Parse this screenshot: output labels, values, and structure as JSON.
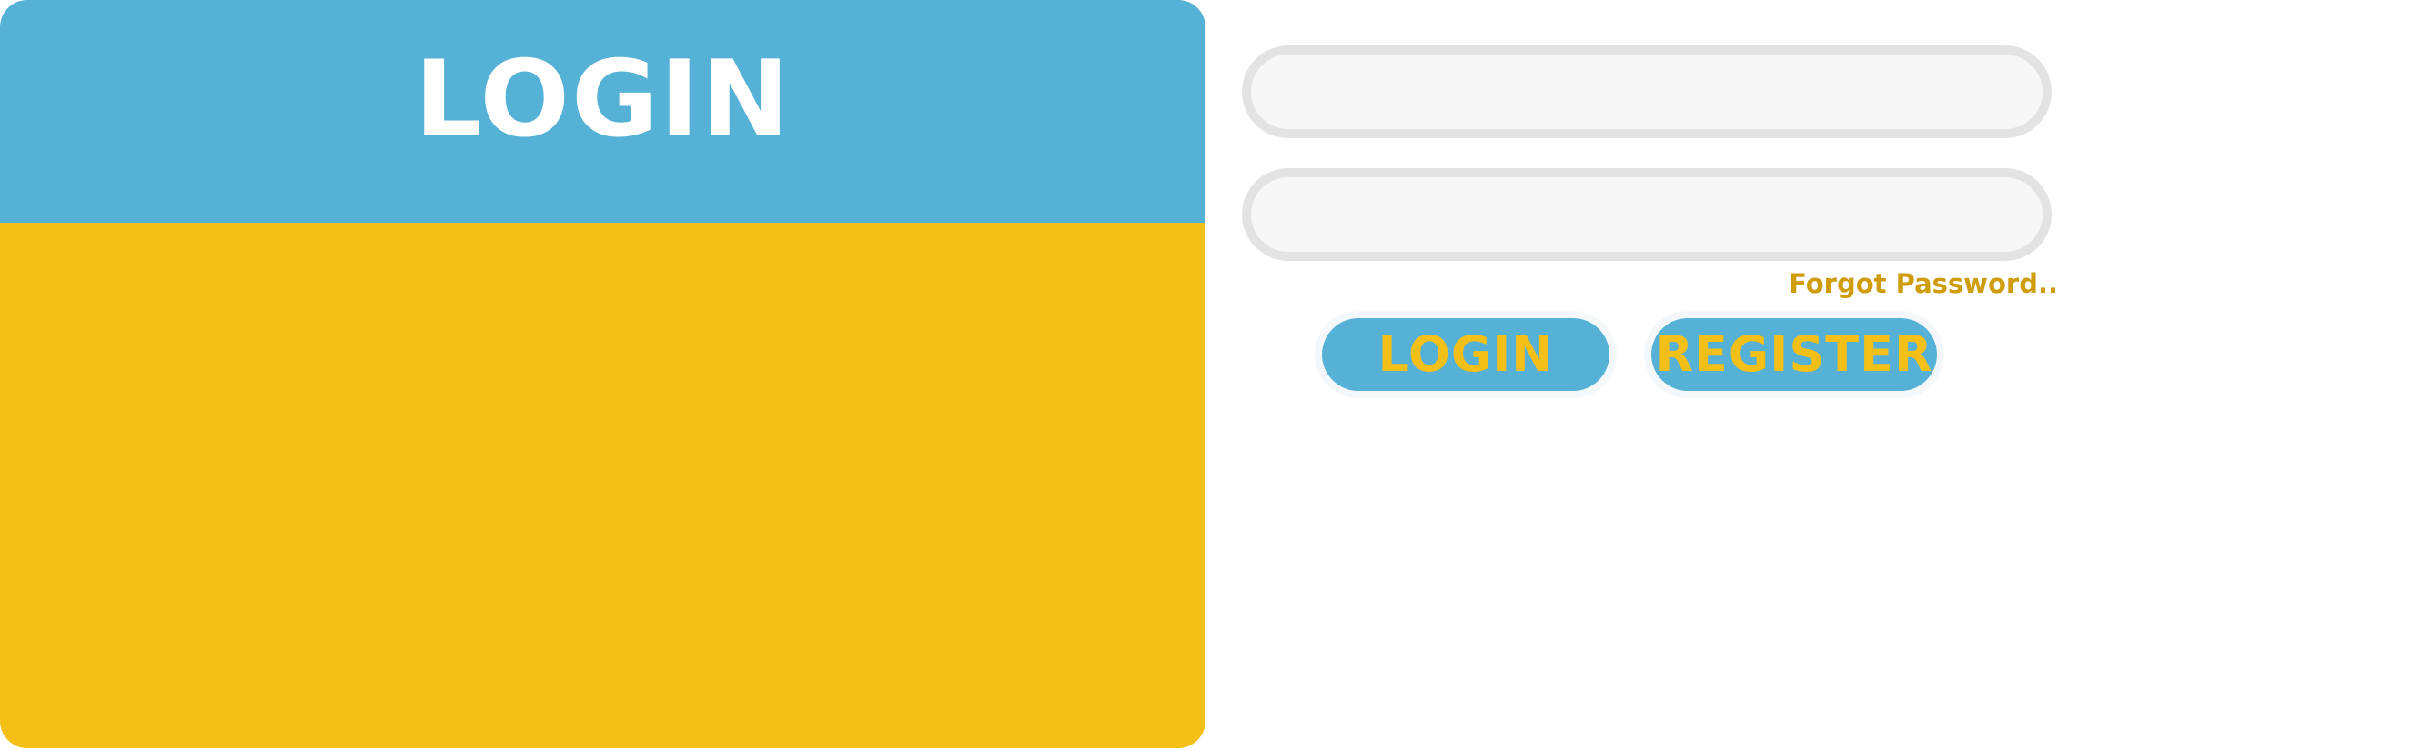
{
  "colors": {
    "blue": "#55b1d6",
    "yellow": "#f4bf17",
    "gold_text": "#cf9d0c",
    "white": "#ffffff"
  },
  "card": {
    "title": "LOGIN"
  },
  "form": {
    "username": {
      "value": "",
      "placeholder": ""
    },
    "password": {
      "value": "",
      "placeholder": ""
    },
    "forgot_password": "Forgot Password..",
    "login_button": "LOGIN",
    "register_button": "REGISTER"
  }
}
